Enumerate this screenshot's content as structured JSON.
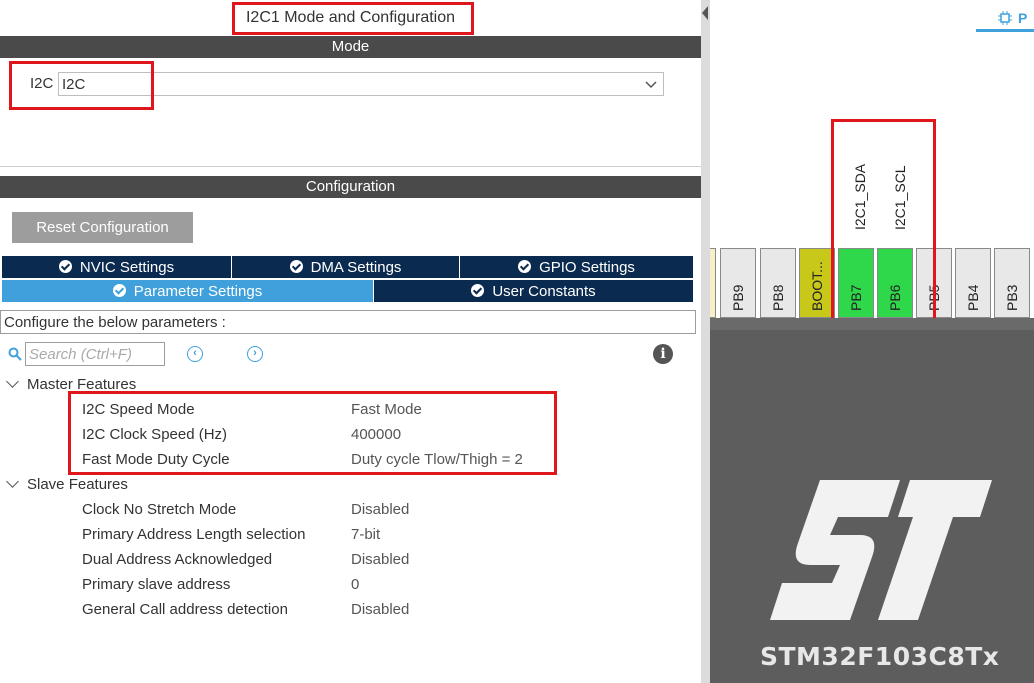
{
  "left_panel": {
    "title": "I2C1 Mode and Configuration",
    "mode_bar": "Mode",
    "i2c_label": "I2C",
    "i2c_select_value": "I2C",
    "config_bar": "Configuration",
    "reset_button": "Reset Configuration",
    "tabs_row1": [
      "NVIC Settings",
      "DMA Settings",
      "GPIO Settings"
    ],
    "tabs_row2": [
      "Parameter Settings",
      "User Constants"
    ],
    "active_tab": "Parameter Settings",
    "configure_text": "Configure the below parameters :",
    "search_placeholder": "Search (Ctrl+F)",
    "prev_icon": "arrow-left-circle-icon",
    "next_icon": "arrow-right-circle-icon",
    "info_icon": "info-icon",
    "groups": [
      {
        "name": "Master Features",
        "params": [
          {
            "label": "I2C Speed Mode",
            "value": "Fast Mode"
          },
          {
            "label": "I2C Clock Speed (Hz)",
            "value": "400000"
          },
          {
            "label": "Fast Mode Duty Cycle",
            "value": "Duty cycle Tlow/Thigh = 2"
          }
        ]
      },
      {
        "name": "Slave Features",
        "params": [
          {
            "label": "Clock No Stretch Mode",
            "value": "Disabled"
          },
          {
            "label": "Primary Address Length selection",
            "value": "7-bit"
          },
          {
            "label": "Dual Address Acknowledged",
            "value": "Disabled"
          },
          {
            "label": "Primary slave address",
            "value": "0"
          },
          {
            "label": "General Call address detection",
            "value": "Disabled"
          }
        ]
      }
    ]
  },
  "right_panel": {
    "tab_label": "P",
    "pins": [
      "PB9",
      "PB8",
      "BOOT...",
      "PB7",
      "PB6",
      "PB5",
      "PB4",
      "PB3"
    ],
    "signals": [
      "I2C1_SDA",
      "I2C1_SCL"
    ],
    "chip_name": "STM32F103C8Tx",
    "logo": "st-logo"
  },
  "colors": {
    "header_bar": "#4a4a4a",
    "tab_dark": "#0b2a4f",
    "tab_active": "#3fa0dc",
    "pin_assigned": "#2fd84b",
    "pin_boot": "#c8c81a",
    "highlight": "#e0161d",
    "chip_body": "#5d5d5d"
  }
}
